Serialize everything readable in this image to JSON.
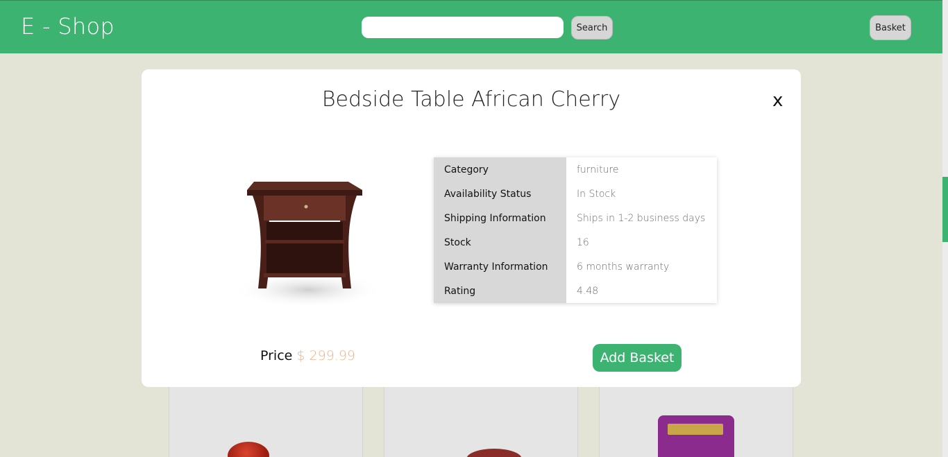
{
  "header": {
    "brand": "E - Shop",
    "search_placeholder": "",
    "search_button": "Search",
    "basket_button": "Basket"
  },
  "modal": {
    "title": "Bedside Table African Cherry",
    "close_label": "x",
    "details": [
      {
        "label": "Category",
        "value": "furniture"
      },
      {
        "label": "Availability Status",
        "value": "In Stock"
      },
      {
        "label": "Shipping Information",
        "value": "Ships in 1-2 business days"
      },
      {
        "label": "Stock",
        "value": "16"
      },
      {
        "label": "Warranty Information",
        "value": "6 months warranty"
      },
      {
        "label": "Rating",
        "value": "4.48"
      }
    ],
    "price_label": "Price",
    "price_value": "$ 299.99",
    "add_basket": "Add Basket"
  },
  "colors": {
    "brand_green": "#3cb371",
    "price_orange": "#f3b383",
    "page_bg": "#e4e4d6"
  },
  "icons": {
    "close": "close-icon",
    "product": "bedside-table-image"
  }
}
